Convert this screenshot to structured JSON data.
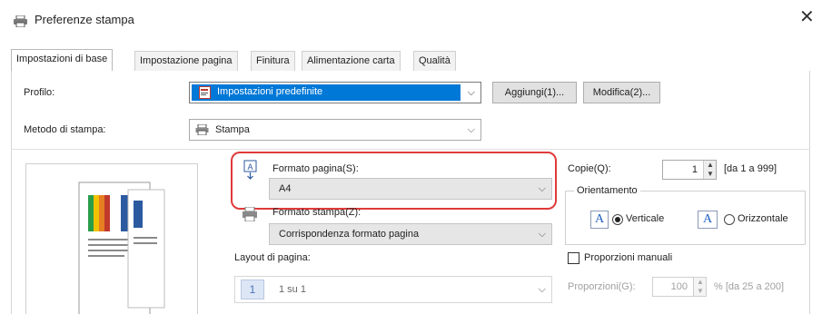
{
  "window": {
    "title": "Preferenze stampa",
    "close_glyph": "✕",
    "icon": "printer-icon"
  },
  "tabs": [
    {
      "label": "Impostazioni di base",
      "active": true
    },
    {
      "label": "Impostazione pagina"
    },
    {
      "label": "Finitura"
    },
    {
      "label": "Alimentazione carta"
    },
    {
      "label": "Qualità"
    }
  ],
  "profile": {
    "label": "Profilo:",
    "selected": "Impostazioni predefinite",
    "add_button": "Aggiungi(1)...",
    "edit_button": "Modifica(2)..."
  },
  "print_method": {
    "label": "Metodo di stampa:",
    "value": "Stampa"
  },
  "page_size": {
    "label": "Formato pagina(S):",
    "value": "A4"
  },
  "output_size": {
    "label": "Formato stampa(Z):",
    "value": "Corrispondenza formato pagina"
  },
  "page_layout": {
    "label": "Layout di pagina:",
    "value": "1 su 1",
    "icon_glyph": "1"
  },
  "copies": {
    "label": "Copie(Q):",
    "value": "1",
    "range": "[da 1 a 999]"
  },
  "orientation": {
    "label": "Orientamento",
    "icon_glyph": "A",
    "portrait": "Verticale",
    "landscape": "Orizzontale",
    "selected": "portrait"
  },
  "manual_scaling": {
    "label": "Proporzioni manuali",
    "checked": false,
    "scale_label": "Proporzioni(G):",
    "scale_value": "100",
    "scale_range": "% [da 25 a 200]"
  },
  "colors": {
    "highlight": "#e03a3a",
    "selection": "#0078d7"
  }
}
